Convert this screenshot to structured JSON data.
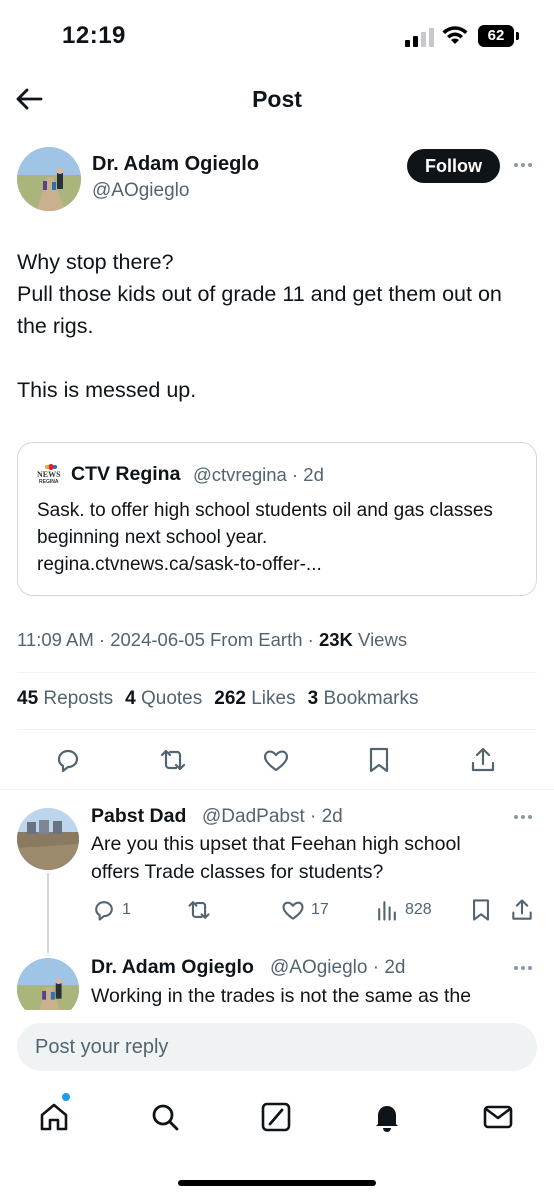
{
  "status_bar": {
    "time": "12:19",
    "battery": "62"
  },
  "header": {
    "title": "Post"
  },
  "post": {
    "author_name": "Dr. Adam Ogieglo",
    "author_handle": "@AOgieglo",
    "follow_label": "Follow",
    "text": "Why stop there?\nPull those kids out of grade 11 and get them out on the rigs.\n\nThis is messed up.",
    "quote": {
      "logo_text": "NEWS REGINA",
      "source_name": "CTV Regina",
      "handle_time": "@ctvregina · 2d",
      "text": "Sask. to offer high school students oil and gas classes beginning next school year.\nregina.ctvnews.ca/sask-to-offer-..."
    },
    "meta": {
      "time_date": "11:09 AM · 2024-06-05 From Earth · ",
      "views_count": "23K",
      "views_label": " Views"
    },
    "stats": [
      {
        "count": "45",
        "label": "Reposts"
      },
      {
        "count": "4",
        "label": "Quotes"
      },
      {
        "count": "262",
        "label": "Likes"
      },
      {
        "count": "3",
        "label": "Bookmarks"
      }
    ]
  },
  "replies": [
    {
      "name": "Pabst Dad",
      "handle_time": "@DadPabst · 2d",
      "text": "Are you this upset that Feehan high school\noffers Trade classes for students?",
      "reply_count": "1",
      "like_count": "17",
      "view_count": "828"
    },
    {
      "name": "Dr. Adam Ogieglo",
      "handle_time": "@AOgieglo · 2d",
      "text": "Working in the trades is not the same as the"
    }
  ],
  "composer": {
    "placeholder": "Post your reply"
  },
  "colors": {
    "text": "#0f1419",
    "secondary": "#536471",
    "accent": "#1d9bf0",
    "divider": "#eff3f4"
  },
  "icons": [
    "back-arrow-icon",
    "more-icon",
    "reply-icon",
    "repost-icon",
    "like-icon",
    "bookmark-icon",
    "share-icon",
    "views-icon",
    "home-icon",
    "search-icon",
    "grok-icon",
    "notifications-icon",
    "messages-icon"
  ]
}
